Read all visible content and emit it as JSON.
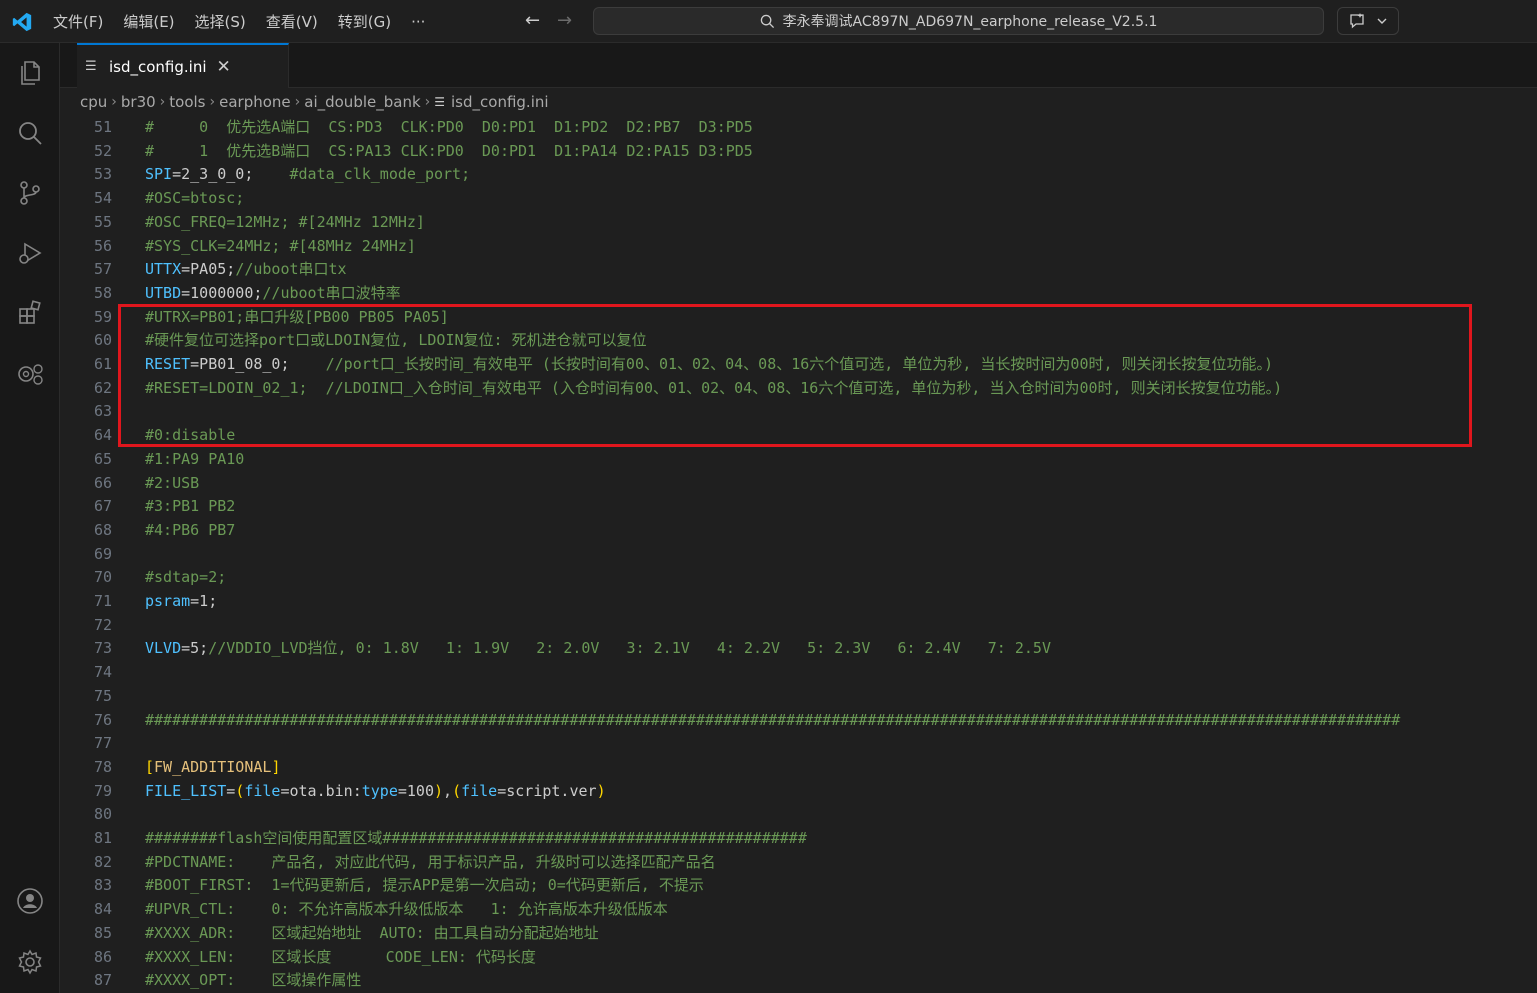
{
  "menu": [
    "文件(F)",
    "编辑(E)",
    "选择(S)",
    "查看(V)",
    "转到(G)",
    "···"
  ],
  "search": {
    "text": "李永奉调试AC897N_AD697N_earphone_release_V2.5.1"
  },
  "tab": {
    "label": "isd_config.ini",
    "close": "✕"
  },
  "breadcrumb": [
    "cpu",
    "br30",
    "tools",
    "earphone",
    "ai_double_bank",
    "isd_config.ini"
  ],
  "colors": {
    "accent": "#0078d4",
    "highlight": "#e0161d",
    "comment": "#6a9955",
    "key": "#4fc1ff"
  },
  "lines": [
    {
      "n": "51",
      "t": [
        [
          "c-comment",
          "#     0  优先选A端口  CS:PD3  CLK:PD0  D0:PD1  D1:PD2  D2:PB7  D3:PD5"
        ]
      ]
    },
    {
      "n": "52",
      "t": [
        [
          "c-comment",
          "#     1  优先选B端口  CS:PA13 CLK:PD0  D0:PD1  D1:PA14 D2:PA15 D3:PD5"
        ]
      ]
    },
    {
      "n": "53",
      "t": [
        [
          "c-key",
          "SPI"
        ],
        [
          "c-plain",
          "=2_3_0_0;    "
        ],
        [
          "c-comment",
          "#data_clk_mode_port;"
        ]
      ]
    },
    {
      "n": "54",
      "t": [
        [
          "c-comment",
          "#OSC=btosc;"
        ]
      ]
    },
    {
      "n": "55",
      "t": [
        [
          "c-comment",
          "#OSC_FREQ=12MHz; #[24MHz 12MHz]"
        ]
      ]
    },
    {
      "n": "56",
      "t": [
        [
          "c-comment",
          "#SYS_CLK=24MHz; #[48MHz 24MHz]"
        ]
      ]
    },
    {
      "n": "57",
      "t": [
        [
          "c-key",
          "UTTX"
        ],
        [
          "c-plain",
          "=PA05;"
        ],
        [
          "c-comment",
          "//uboot串口tx"
        ]
      ]
    },
    {
      "n": "58",
      "t": [
        [
          "c-key",
          "UTBD"
        ],
        [
          "c-plain",
          "=1000000;"
        ],
        [
          "c-comment",
          "//uboot串口波特率"
        ]
      ]
    },
    {
      "n": "59",
      "t": [
        [
          "c-comment",
          "#UTRX=PB01;串口升级[PB00 PB05 PA05]"
        ]
      ]
    },
    {
      "n": "60",
      "t": [
        [
          "c-comment",
          "#硬件复位可选择port口或LDOIN复位, LDOIN复位: 死机进仓就可以复位"
        ]
      ]
    },
    {
      "n": "61",
      "t": [
        [
          "c-key",
          "RESET"
        ],
        [
          "c-plain",
          "=PB01_08_0;    "
        ],
        [
          "c-comment",
          "//port口_长按时间_有效电平 (长按时间有00、01、02、04、08、16六个值可选, 单位为秒, 当长按时间为00时, 则关闭长按复位功能。)"
        ]
      ]
    },
    {
      "n": "62",
      "t": [
        [
          "c-comment",
          "#RESET=LDOIN_02_1;  //LDOIN口_入仓时间_有效电平 (入仓时间有00、01、02、04、08、16六个值可选, 单位为秒, 当入仓时间为00时, 则关闭长按复位功能。)"
        ]
      ]
    },
    {
      "n": "63",
      "t": []
    },
    {
      "n": "64",
      "t": [
        [
          "c-comment",
          "#0:disable"
        ]
      ]
    },
    {
      "n": "65",
      "t": [
        [
          "c-comment",
          "#1:PA9 PA10"
        ]
      ]
    },
    {
      "n": "66",
      "t": [
        [
          "c-comment",
          "#2:USB"
        ]
      ]
    },
    {
      "n": "67",
      "t": [
        [
          "c-comment",
          "#3:PB1 PB2"
        ]
      ]
    },
    {
      "n": "68",
      "t": [
        [
          "c-comment",
          "#4:PB6 PB7"
        ]
      ]
    },
    {
      "n": "69",
      "t": []
    },
    {
      "n": "70",
      "t": [
        [
          "c-comment",
          "#sdtap=2;"
        ]
      ]
    },
    {
      "n": "71",
      "t": [
        [
          "c-key",
          "psram"
        ],
        [
          "c-plain",
          "=1;"
        ]
      ]
    },
    {
      "n": "72",
      "t": []
    },
    {
      "n": "73",
      "t": [
        [
          "c-key",
          "VLVD"
        ],
        [
          "c-plain",
          "=5;"
        ],
        [
          "c-comment",
          "//VDDIO_LVD挡位, 0: 1.8V   1: 1.9V   2: 2.0V   3: 2.1V   4: 2.2V   5: 2.3V   6: 2.4V   7: 2.5V"
        ]
      ]
    },
    {
      "n": "74",
      "t": []
    },
    {
      "n": "75",
      "t": []
    },
    {
      "n": "76",
      "t": [
        [
          "c-comment",
          "###########################################################################################################################################"
        ]
      ]
    },
    {
      "n": "77",
      "t": []
    },
    {
      "n": "78",
      "t": [
        [
          "c-bracket",
          "["
        ],
        [
          "c-section",
          "FW_ADDITIONAL"
        ],
        [
          "c-bracket",
          "]"
        ]
      ]
    },
    {
      "n": "79",
      "t": [
        [
          "c-key",
          "FILE_LIST"
        ],
        [
          "c-plain",
          "="
        ],
        [
          "c-bracket",
          "("
        ],
        [
          "c-key",
          "file"
        ],
        [
          "c-plain",
          "=ota.bin:"
        ],
        [
          "c-key",
          "type"
        ],
        [
          "c-plain",
          "=100"
        ],
        [
          "c-bracket",
          ")"
        ],
        [
          "c-plain",
          ","
        ],
        [
          "c-bracket",
          "("
        ],
        [
          "c-key",
          "file"
        ],
        [
          "c-plain",
          "=script.ver"
        ],
        [
          "c-bracket",
          ")"
        ]
      ]
    },
    {
      "n": "80",
      "t": []
    },
    {
      "n": "81",
      "t": [
        [
          "c-comment",
          "########flash空间使用配置区域###############################################"
        ]
      ]
    },
    {
      "n": "82",
      "t": [
        [
          "c-comment",
          "#PDCTNAME:    产品名, 对应此代码, 用于标识产品, 升级时可以选择匹配产品名"
        ]
      ]
    },
    {
      "n": "83",
      "t": [
        [
          "c-comment",
          "#BOOT_FIRST:  1=代码更新后, 提示APP是第一次启动; 0=代码更新后, 不提示"
        ]
      ]
    },
    {
      "n": "84",
      "t": [
        [
          "c-comment",
          "#UPVR_CTL:    0: 不允许高版本升级低版本   1: 允许高版本升级低版本"
        ]
      ]
    },
    {
      "n": "85",
      "t": [
        [
          "c-comment",
          "#XXXX_ADR:    区域起始地址  AUTO: 由工具自动分配起始地址"
        ]
      ]
    },
    {
      "n": "86",
      "t": [
        [
          "c-comment",
          "#XXXX_LEN:    区域长度      CODE_LEN: 代码长度"
        ]
      ]
    },
    {
      "n": "87",
      "t": [
        [
          "c-comment",
          "#XXXX_OPT:    区域操作属性"
        ]
      ]
    }
  ]
}
